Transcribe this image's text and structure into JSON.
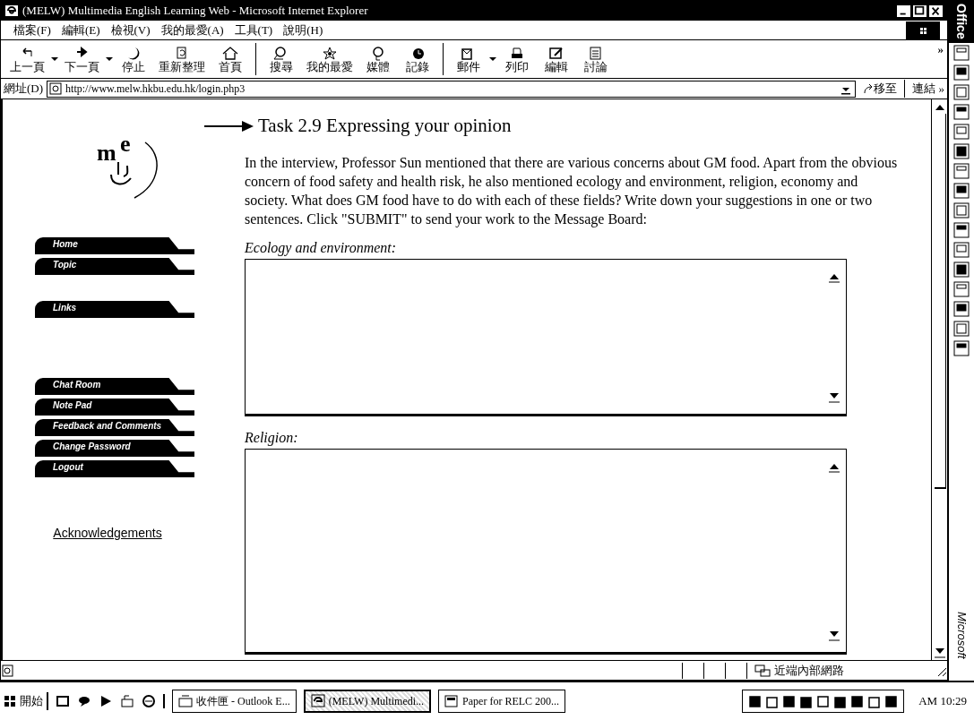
{
  "window": {
    "title": "(MELW) Multimedia English Learning Web - Microsoft Internet Explorer"
  },
  "menu": [
    "檔案(F)",
    "編輯(E)",
    "檢視(V)",
    "我的最愛(A)",
    "工具(T)",
    "說明(H)"
  ],
  "toolbar": [
    {
      "kind": "back",
      "label": "上一頁",
      "dropdown": true
    },
    {
      "kind": "forward",
      "label": "下一頁",
      "dropdown": true
    },
    {
      "kind": "stop",
      "label": "停止",
      "dropdown": false
    },
    {
      "kind": "refresh",
      "label": "重新整理",
      "dropdown": false
    },
    {
      "kind": "home",
      "label": "首頁",
      "dropdown": false
    },
    {
      "kind": "search",
      "label": "搜尋",
      "dropdown": false
    },
    {
      "kind": "favorites",
      "label": "我的最愛",
      "dropdown": false
    },
    {
      "kind": "media",
      "label": "媒體",
      "dropdown": false
    },
    {
      "kind": "history",
      "label": "記錄",
      "dropdown": false
    },
    {
      "kind": "mail",
      "label": "郵件",
      "dropdown": true
    },
    {
      "kind": "print",
      "label": "列印",
      "dropdown": false
    },
    {
      "kind": "edit",
      "label": "編輯",
      "dropdown": false
    },
    {
      "kind": "discuss",
      "label": "討論",
      "dropdown": false
    }
  ],
  "toolbar_more": "»",
  "address": {
    "label": "網址(D)",
    "url": "http://www.melw.hkbu.edu.hk/login.php3",
    "go": "移至",
    "links": "連結",
    "links_more": "»"
  },
  "logo": [
    "m",
    "e"
  ],
  "nav_groups": [
    [
      "Home",
      "Topic"
    ],
    [
      "Links"
    ],
    [
      "Chat Room",
      "Note Pad",
      "Feedback and Comments",
      "Change Password",
      "Logout"
    ]
  ],
  "acknowledgements": "Acknowledgements",
  "task": {
    "heading": "Task 2.9 Expressing your opinion",
    "instructions": "In the interview, Professor Sun mentioned that there are various concerns about GM food. Apart from the obvious concern of food safety and health risk, he also mentioned ecology and environment, religion, economy and society. What does GM food have to do with each of these fields? Write down your suggestions in one or two sentences. Click \"SUBMIT\" to send your work to the Message Board:",
    "fields": [
      {
        "label": "Ecology and environment:"
      },
      {
        "label": "Religion:"
      }
    ]
  },
  "status_bar": {
    "zone": "近端內部網路"
  },
  "taskbar": {
    "start": "開始",
    "tasks": [
      {
        "label": "收件匣 - Outlook E...",
        "selected": false
      },
      {
        "label": "(MELW) Multimedi...",
        "selected": true
      },
      {
        "label": "Paper for RELC 200...",
        "selected": false
      }
    ],
    "clock": "AM 10:29"
  },
  "office_bar": {
    "title": "Office",
    "footer": "Microsoft"
  }
}
